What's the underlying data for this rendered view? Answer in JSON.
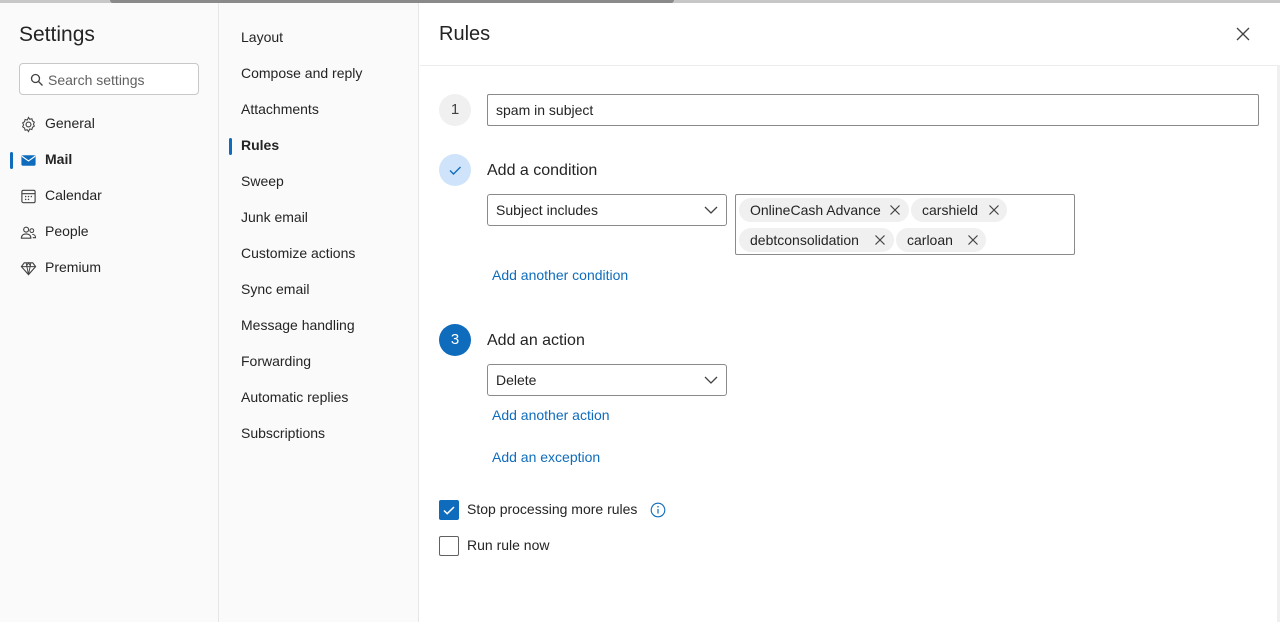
{
  "settings": {
    "title": "Settings",
    "search_placeholder": "Search settings",
    "items": [
      {
        "label": "General",
        "icon": "gear-icon"
      },
      {
        "label": "Mail",
        "icon": "mail-icon",
        "active": true
      },
      {
        "label": "Calendar",
        "icon": "calendar-icon"
      },
      {
        "label": "People",
        "icon": "people-icon"
      },
      {
        "label": "Premium",
        "icon": "diamond-icon"
      }
    ]
  },
  "mail_nav": {
    "items": [
      "Layout",
      "Compose and reply",
      "Attachments",
      "Rules",
      "Sweep",
      "Junk email",
      "Customize actions",
      "Sync email",
      "Message handling",
      "Forwarding",
      "Automatic replies",
      "Subscriptions"
    ],
    "active": "Rules"
  },
  "rules": {
    "heading": "Rules",
    "step1_number": "1",
    "rule_name": "spam in subject",
    "condition": {
      "label": "Add a condition",
      "type": "Subject includes",
      "keywords": [
        "OnlineCash Advance",
        "carshield",
        "debtconsolidation",
        "carloan"
      ],
      "add_link": "Add another condition"
    },
    "action": {
      "number": "3",
      "label": "Add an action",
      "type": "Delete",
      "add_link": "Add another action",
      "exception_link": "Add an exception"
    },
    "options": {
      "stop_processing": {
        "label": "Stop processing more rules",
        "checked": true
      },
      "run_now": {
        "label": "Run rule now",
        "checked": false
      }
    }
  },
  "colors": {
    "accent": "#0f6cbd",
    "step_done_bg": "#cfe4fa"
  }
}
